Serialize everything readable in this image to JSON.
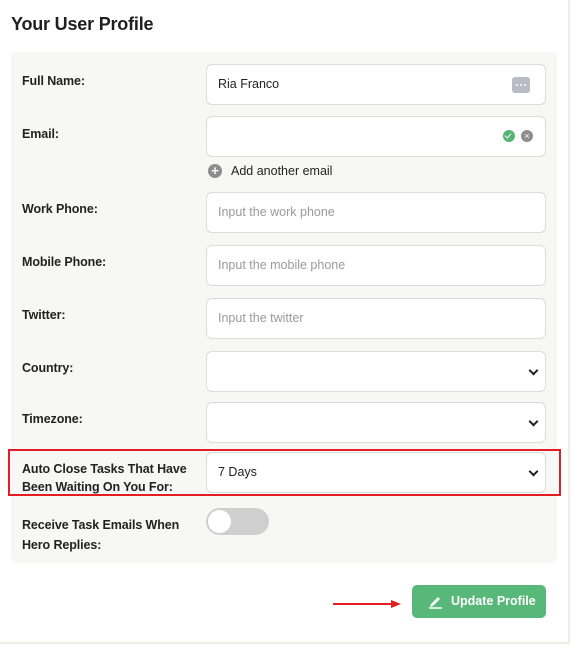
{
  "page": {
    "title": "Your User Profile"
  },
  "form": {
    "full_name": {
      "label": "Full Name:",
      "value": "Ria Franco"
    },
    "email": {
      "label": "Email:",
      "value": ""
    },
    "add_email": {
      "label": "Add another email"
    },
    "work_phone": {
      "label": "Work Phone:",
      "placeholder": "Input the work phone"
    },
    "mobile_phone": {
      "label": "Mobile Phone:",
      "placeholder": "Input the mobile phone"
    },
    "twitter": {
      "label": "Twitter:",
      "placeholder": "Input the twitter"
    },
    "country": {
      "label": "Country:",
      "value": ""
    },
    "timezone": {
      "label": "Timezone:",
      "value": ""
    },
    "auto_close": {
      "label_line1": "Auto Close Tasks That Have",
      "label_line2": "Been Waiting On You For:",
      "value": "7 Days"
    },
    "task_emails": {
      "label_line1": "Receive Task Emails When",
      "label_line2": "Hero Replies:",
      "enabled": false
    }
  },
  "actions": {
    "update_label": "Update Profile"
  },
  "colors": {
    "primary_button": "#57b87a",
    "highlight": "#e41c23",
    "panel_background": "#f7f7f5"
  },
  "icons": {
    "name_field": "dots-icon",
    "email_valid": "check-icon",
    "email_clear": "clear-icon",
    "add_email": "plus-circle-icon",
    "select": "chevron-down-icon",
    "update": "edit-icon",
    "annotation": "arrow-icon"
  }
}
